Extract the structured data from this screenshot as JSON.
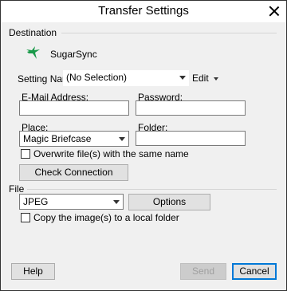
{
  "window": {
    "title": "Transfer Settings"
  },
  "destination": {
    "group_label": "Destination",
    "service_name": "SugarSync",
    "logo_icon": "hummingbird-logo-icon",
    "setting_name_label": "Setting Name:",
    "setting_name_value": "(No Selection)",
    "edit_label": "Edit",
    "email_label": "E-Mail Address:",
    "email_value": "",
    "password_label": "Password:",
    "password_value": "",
    "place_label": "Place:",
    "place_value": "Magic Briefcase",
    "folder_label": "Folder:",
    "folder_value": "",
    "overwrite_label": "Overwrite file(s) with the same name",
    "overwrite_checked": false,
    "check_connection_label": "Check Connection"
  },
  "file": {
    "group_label": "File",
    "format_value": "JPEG",
    "options_label": "Options",
    "copy_local_label": "Copy the image(s) to a local folder",
    "copy_local_checked": false
  },
  "footer": {
    "help_label": "Help",
    "send_label": "Send",
    "cancel_label": "Cancel"
  },
  "colors": {
    "logo_green": "#1a9a4a",
    "default_button_border": "#0078d7"
  }
}
